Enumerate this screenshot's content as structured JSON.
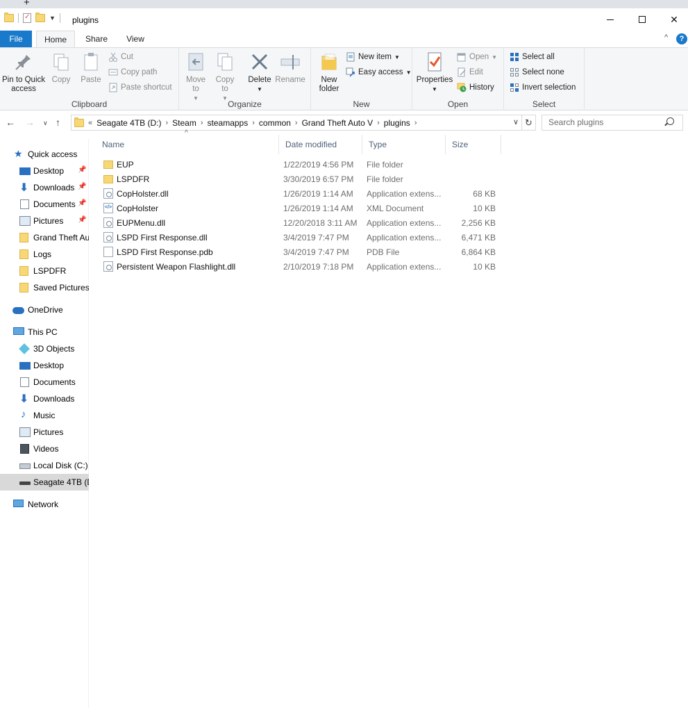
{
  "window": {
    "title": "plugins",
    "tab_plus": "+",
    "controls": {
      "close": "✕"
    }
  },
  "ribbon_tabs": {
    "file": "File",
    "home": "Home",
    "share": "Share",
    "view": "View",
    "collapse": "^",
    "help": "?"
  },
  "ribbon": {
    "clipboard": {
      "label": "Clipboard",
      "pin": "Pin to Quick access",
      "copy": "Copy",
      "paste": "Paste",
      "cut": "Cut",
      "copy_path": "Copy path",
      "paste_shortcut": "Paste shortcut"
    },
    "organize": {
      "label": "Organize",
      "move_to": "Move to",
      "copy_to": "Copy to",
      "delete": "Delete",
      "rename": "Rename"
    },
    "new": {
      "label": "New",
      "new_folder": "New folder",
      "new_item": "New item",
      "easy_access": "Easy access"
    },
    "open": {
      "label": "Open",
      "properties": "Properties",
      "open": "Open",
      "edit": "Edit",
      "history": "History"
    },
    "select": {
      "label": "Select",
      "select_all": "Select all",
      "select_none": "Select none",
      "invert": "Invert selection"
    }
  },
  "address": {
    "overflow": "«",
    "crumbs": [
      "Seagate 4TB (D:)",
      "Steam",
      "steamapps",
      "common",
      "Grand Theft Auto V",
      "plugins"
    ],
    "search_placeholder": "Search plugins"
  },
  "nav": {
    "quick_access": "Quick access",
    "quick_items": [
      "Desktop",
      "Downloads",
      "Documents",
      "Pictures",
      "Grand Theft Au",
      "Logs",
      "LSPDFR",
      "Saved Pictures"
    ],
    "onedrive": "OneDrive",
    "this_pc": "This PC",
    "pc_items": [
      "3D Objects",
      "Desktop",
      "Documents",
      "Downloads",
      "Music",
      "Pictures",
      "Videos",
      "Local Disk (C:)",
      "Seagate 4TB (D"
    ],
    "network": "Network"
  },
  "columns": {
    "name": "Name",
    "date": "Date modified",
    "type": "Type",
    "size": "Size"
  },
  "files": [
    {
      "name": "EUP",
      "date": "1/22/2019 4:56 PM",
      "type": "File folder",
      "size": "",
      "icon": "folder-icon"
    },
    {
      "name": "LSPDFR",
      "date": "3/30/2019 6:57 PM",
      "type": "File folder",
      "size": "",
      "icon": "folder-icon"
    },
    {
      "name": "CopHolster.dll",
      "date": "1/26/2019 1:14 AM",
      "type": "Application extens...",
      "size": "68 KB",
      "icon": "dll-icon"
    },
    {
      "name": "CopHolster",
      "date": "1/26/2019 1:14 AM",
      "type": "XML Document",
      "size": "10 KB",
      "icon": "xml-icon"
    },
    {
      "name": "EUPMenu.dll",
      "date": "12/20/2018 3:11 AM",
      "type": "Application extens...",
      "size": "2,256 KB",
      "icon": "dll-icon"
    },
    {
      "name": "LSPD First Response.dll",
      "date": "3/4/2019 7:47 PM",
      "type": "Application extens...",
      "size": "6,471 KB",
      "icon": "dll-icon"
    },
    {
      "name": "LSPD First Response.pdb",
      "date": "3/4/2019 7:47 PM",
      "type": "PDB File",
      "size": "6,864 KB",
      "icon": "pdb-icon"
    },
    {
      "name": "Persistent Weapon Flashlight.dll",
      "date": "2/10/2019 7:18 PM",
      "type": "Application extens...",
      "size": "10 KB",
      "icon": "dll-icon"
    }
  ],
  "colors": {
    "accent": "#1979ca",
    "selected_nav": "#cce8ff",
    "folder": "#f8d775",
    "header_text": "#4c607a"
  }
}
